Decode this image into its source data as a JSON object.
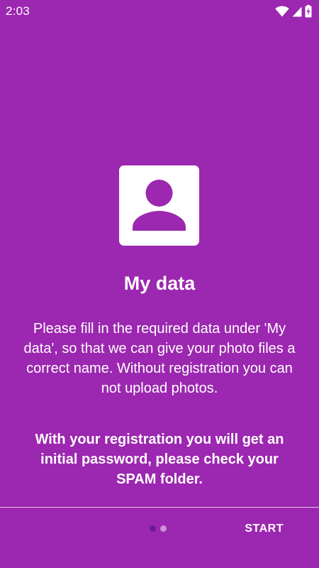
{
  "status_bar": {
    "time": "2:03",
    "icons": [
      "wifi-icon",
      "signal-icon",
      "battery-charging-icon"
    ]
  },
  "onboarding": {
    "icon": "person-icon",
    "title": "My data",
    "description": "Please fill in the required data under 'My data', so that we can give your photo files a correct name. Without registration you can not upload photos.",
    "note": "With your registration you will get an initial password, please check your SPAM folder."
  },
  "pager": {
    "page_count": 2,
    "current_page": 1
  },
  "footer": {
    "start_label": "START"
  },
  "colors": {
    "background": "#9C27B0",
    "active_dot": "#6A1B9A",
    "inactive_dot": "#CE93D8",
    "text": "#FFFFFF"
  }
}
